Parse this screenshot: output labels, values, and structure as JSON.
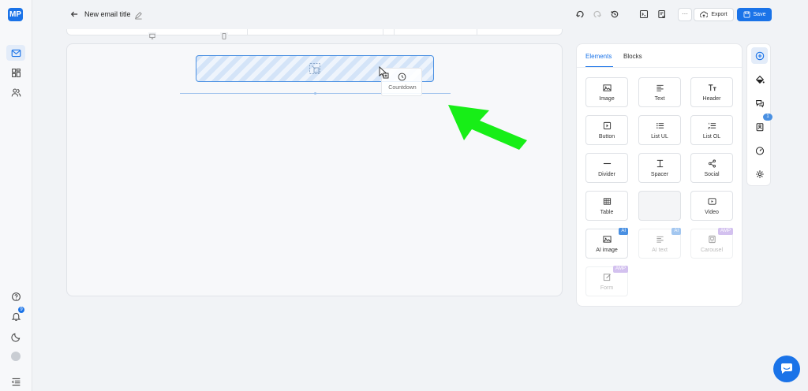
{
  "app": {
    "logo": "MP"
  },
  "header": {
    "title": "New email title",
    "export_label": "Export",
    "save_label": "Save",
    "more_label": "···"
  },
  "nav": {
    "notifications_count": "9"
  },
  "canvas": {
    "drag_label": "Countdown"
  },
  "panel": {
    "tabs": [
      "Elements",
      "Blocks"
    ],
    "elements": [
      {
        "label": "Image",
        "icon": "image-icon"
      },
      {
        "label": "Text",
        "icon": "text-icon"
      },
      {
        "label": "Header",
        "icon": "header-icon"
      },
      {
        "label": "Button",
        "icon": "button-icon"
      },
      {
        "label": "List UL",
        "icon": "list-ul-icon"
      },
      {
        "label": "List OL",
        "icon": "list-ol-icon"
      },
      {
        "label": "Divider",
        "icon": "divider-icon"
      },
      {
        "label": "Spacer",
        "icon": "spacer-icon"
      },
      {
        "label": "Social",
        "icon": "share-icon"
      },
      {
        "label": "Table",
        "icon": "table-icon"
      },
      {
        "label": "",
        "icon": ""
      },
      {
        "label": "Video",
        "icon": "video-icon"
      },
      {
        "label": "AI image",
        "icon": "ai-image-icon",
        "tag": "AI"
      },
      {
        "label": "AI text",
        "icon": "ai-text-icon",
        "tag": "AI"
      },
      {
        "label": "Carousel",
        "icon": "carousel-icon",
        "tag": "AMP"
      },
      {
        "label": "Form",
        "icon": "form-icon",
        "tag": "AMP"
      }
    ]
  },
  "right_toolbar": {
    "badge": "1"
  },
  "colors": {
    "accent": "#1a73e8",
    "arrow": "#17ee17",
    "amp_tag": "#a985e0"
  }
}
